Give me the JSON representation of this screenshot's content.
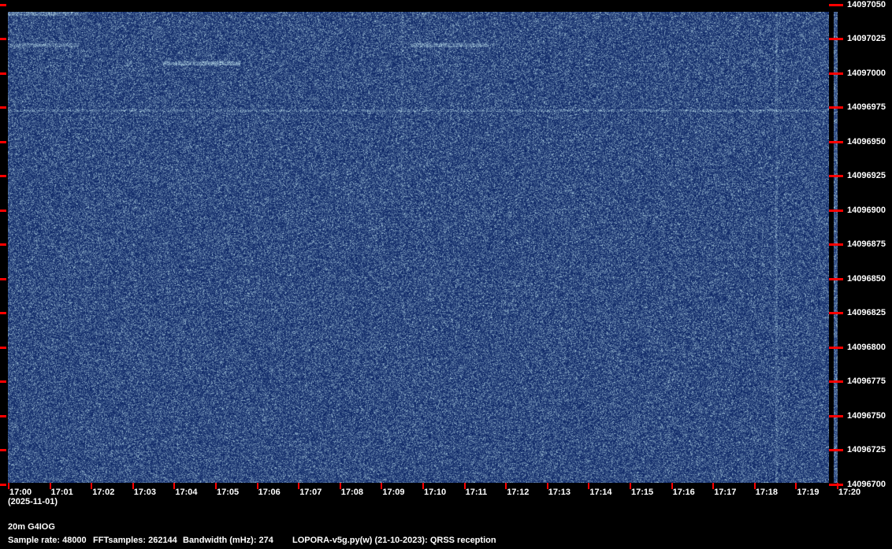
{
  "freq_labels": [
    "14097050",
    "14097025",
    "14097000",
    "14096975",
    "14096950",
    "14096925",
    "14096900",
    "14096875",
    "14096850",
    "14096825",
    "14096800",
    "14096775",
    "14096750",
    "14096725",
    "14096700"
  ],
  "time_labels": [
    "17:00",
    "17:01",
    "17:02",
    "17:03",
    "17:04",
    "17:05",
    "17:06",
    "17:07",
    "17:08",
    "17:09",
    "17:10",
    "17:11",
    "17:12",
    "17:13",
    "17:14",
    "17:15",
    "17:16",
    "17:17",
    "17:18",
    "17:19",
    "17:20"
  ],
  "date": "(2025-11-01)",
  "station": "20m G4IOG",
  "sample_rate": "Sample rate: 48000",
  "fft_samples": "FFTsamples: 262144",
  "bandwidth": "Bandwidth (mHz): 274",
  "software": "LOPORA-v5g.py(w) (21-10-2023): QRSS reception",
  "colors": {
    "background": "#0a2a6e",
    "tick": "#ff0000",
    "text": "#ffffff"
  }
}
